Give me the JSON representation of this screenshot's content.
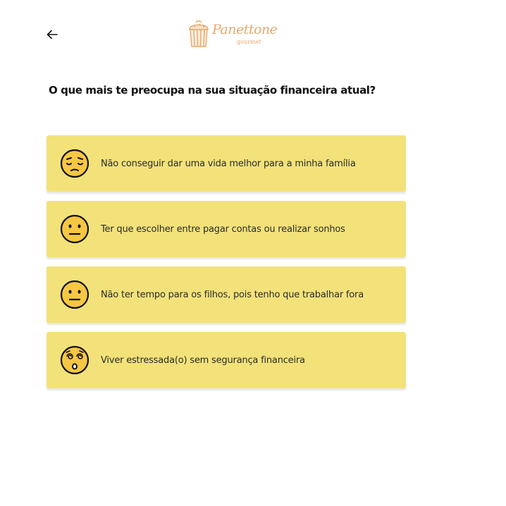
{
  "header": {
    "back_icon": "arrow-left-icon",
    "logo": {
      "name": "Panettone",
      "subtitle": "gourmet",
      "color": "#e3a96f"
    }
  },
  "question": {
    "title": "O que mais te preocupa na sua situação financeira atual?"
  },
  "options": [
    {
      "label": "Não conseguir dar uma vida melhor para a minha família",
      "icon": "pensive-face-icon"
    },
    {
      "label": "Ter que escolher entre pagar contas ou realizar sonhos",
      "icon": "neutral-face-icon"
    },
    {
      "label": "Não ter tempo para os filhos, pois tenho que trabalhar fora",
      "icon": "neutral-face-icon"
    },
    {
      "label": "Viver estressada(o) sem segurança financeira",
      "icon": "dizzy-face-icon"
    }
  ],
  "colors": {
    "card": "#f3e27a",
    "emoji_fill": "#f6c744",
    "text": "#111111"
  }
}
